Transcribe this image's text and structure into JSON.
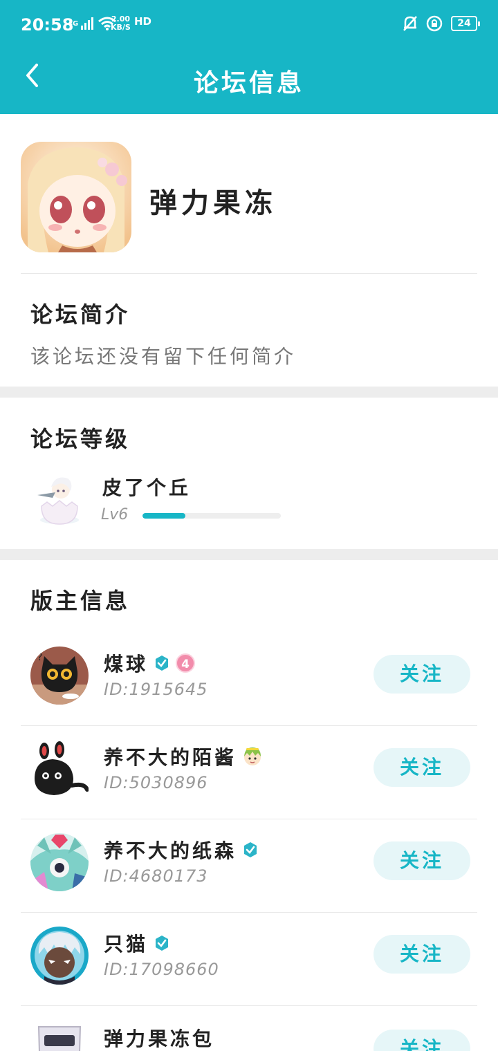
{
  "status_bar": {
    "time": "20:58",
    "network": "4G",
    "speed_value": "2.00",
    "speed_unit": "KB/S",
    "hd": "HD",
    "battery": "24",
    "icons": [
      "signal-icon",
      "wifi-icon",
      "mute-bell-icon",
      "rotation-lock-icon",
      "battery-icon"
    ]
  },
  "nav": {
    "title": "论坛信息",
    "back_icon": "chevron-left-icon"
  },
  "forum": {
    "name": "弹力果冻"
  },
  "intro": {
    "title": "论坛简介",
    "text": "该论坛还没有留下任何简介"
  },
  "level": {
    "title": "论坛等级",
    "name": "皮了个丘",
    "label": "Lv6",
    "progress_fraction": 0.31
  },
  "moderators": {
    "title": "版主信息",
    "follow_label": "关注",
    "items": [
      {
        "name": "煤球",
        "id": "ID:1915645",
        "verified": true,
        "level_badge": "4"
      },
      {
        "name": "养不大的陌酱",
        "id": "ID:5030896",
        "verified": false,
        "level_badge": ""
      },
      {
        "name": "养不大的纸森",
        "id": "ID:4680173",
        "verified": true,
        "level_badge": ""
      },
      {
        "name": "只猫",
        "id": "ID:17098660",
        "verified": true,
        "level_badge": ""
      },
      {
        "name": "弹力果冻包",
        "id": "",
        "verified": false,
        "level_badge": ""
      }
    ]
  },
  "colors": {
    "accent": "#17b6c6",
    "follow_bg": "#e6f6f8",
    "band": "#ededed"
  }
}
